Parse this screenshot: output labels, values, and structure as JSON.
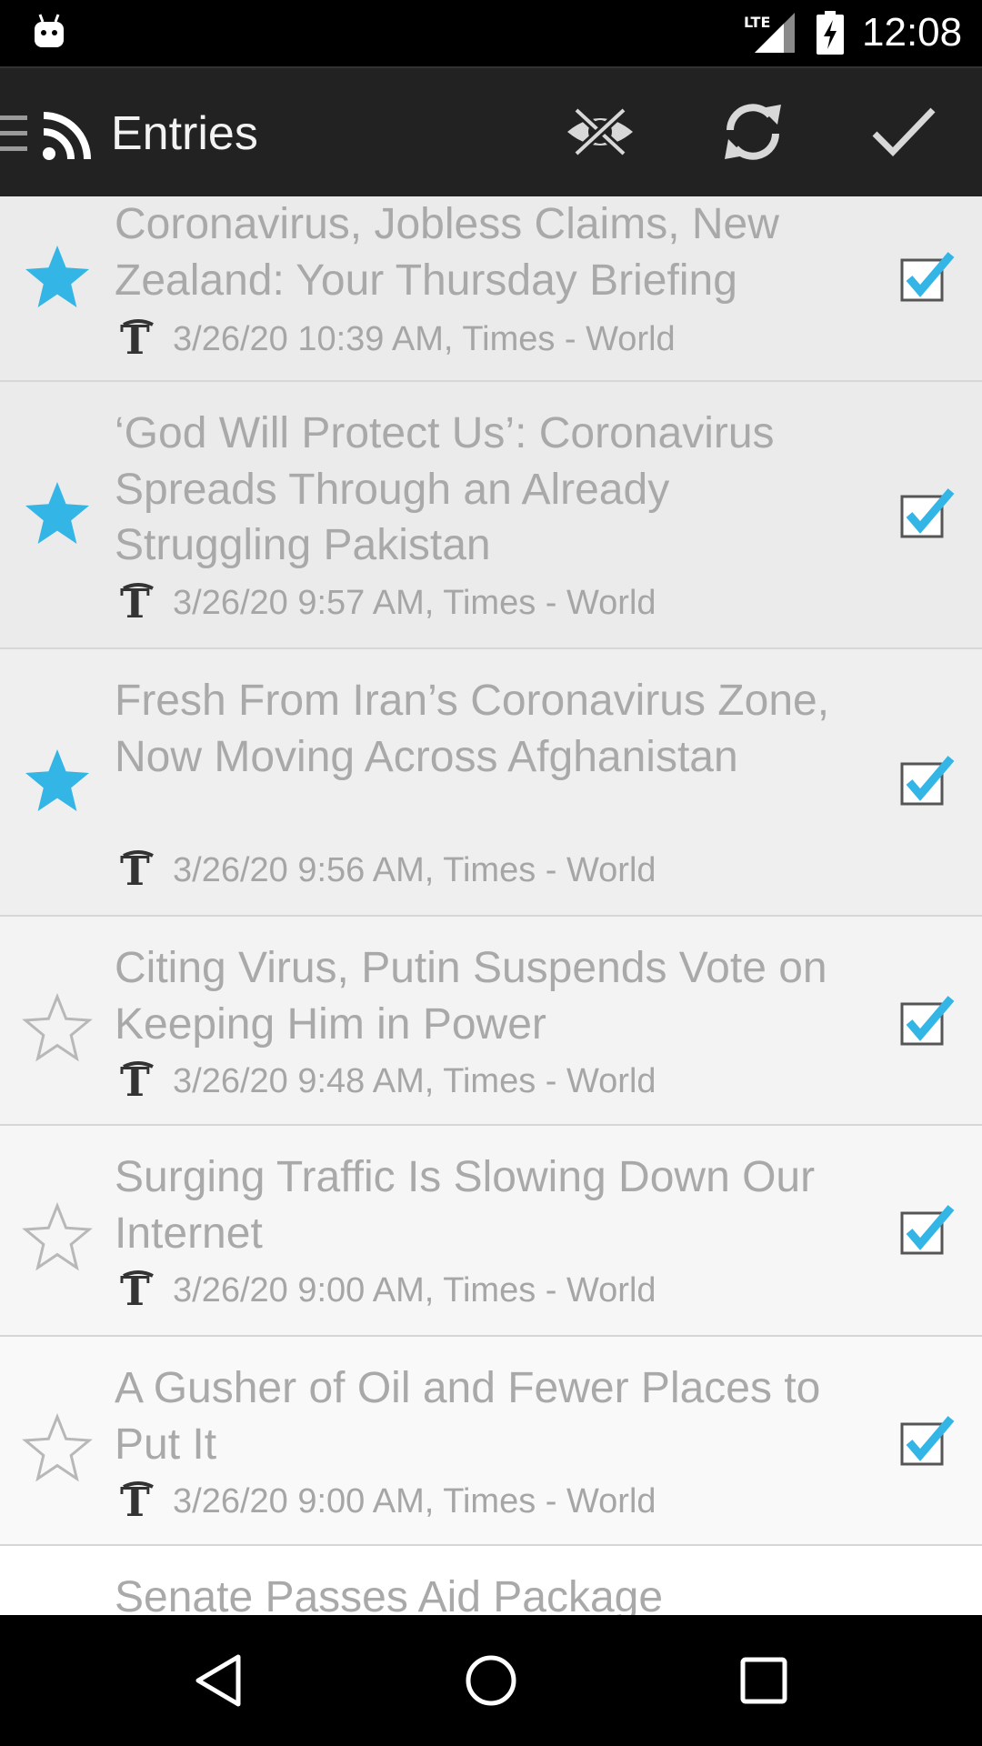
{
  "status_bar": {
    "network": "LTE",
    "time": "12:08"
  },
  "action_bar": {
    "title": "Entries",
    "icons": [
      "drawer-icon",
      "rss-icon",
      "hide-read-icon",
      "refresh-icon",
      "mark-all-read-icon"
    ]
  },
  "colors": {
    "star_active": "#33b5e5",
    "checkbox_check": "#33b5e5",
    "read_text": "#a9a9a9"
  },
  "entries": [
    {
      "title": "Coronavirus, Jobless Claims, New Zealand: Your Thursday Briefing",
      "meta": "3/26/20 10:39 AM, Times - World",
      "starred": true,
      "checked": true
    },
    {
      "title": "‘God Will Protect Us’: Coronavirus Spreads Through an Already Struggling Pakistan",
      "meta": "3/26/20 9:57 AM, Times - World",
      "starred": true,
      "checked": true
    },
    {
      "title": "Fresh From Iran’s Coronavirus Zone, Now Moving Across Afghanistan",
      "meta": "3/26/20 9:56 AM, Times - World",
      "starred": true,
      "checked": true
    },
    {
      "title": "Citing Virus, Putin Suspends Vote on Keeping Him in Power",
      "meta": "3/26/20 9:48 AM, Times - World",
      "starred": false,
      "checked": true
    },
    {
      "title": "Surging Traffic Is Slowing Down Our Internet",
      "meta": "3/26/20 9:00 AM, Times - World",
      "starred": false,
      "checked": true
    },
    {
      "title": "A Gusher of Oil and Fewer Places to Put It",
      "meta": "3/26/20 9:00 AM, Times - World",
      "starred": false,
      "checked": true
    },
    {
      "title": "Senate Passes Aid Package",
      "meta": "",
      "starred": false,
      "checked": false
    }
  ]
}
